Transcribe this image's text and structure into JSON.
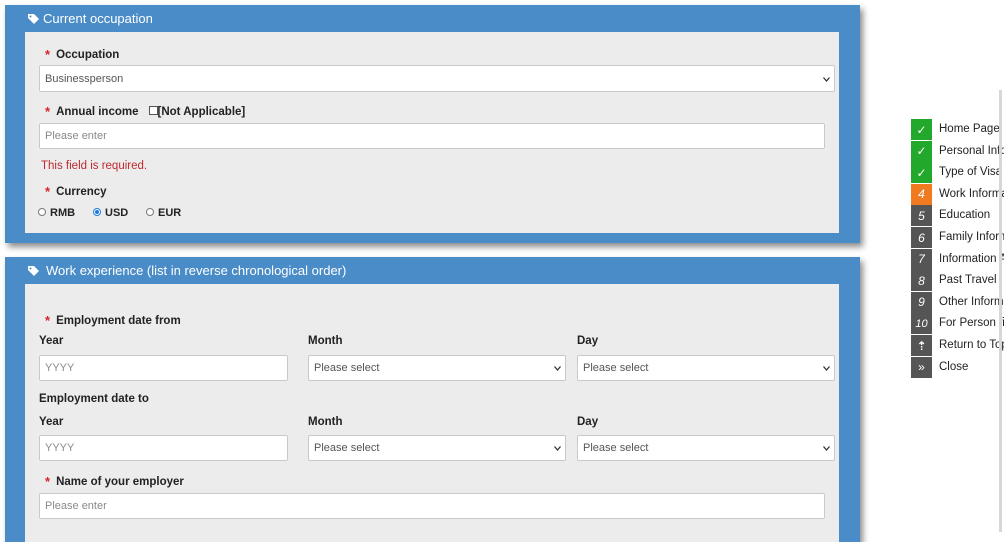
{
  "occupation_panel": {
    "title": "Current occupation",
    "occupation_label": "Occupation",
    "occupation_value": "Businessperson",
    "annual_income_label": "Annual income",
    "not_applicable_label": "[Not Applicable]",
    "annual_income_placeholder": "Please enter",
    "error_text": "This field is required.",
    "currency_label": "Currency",
    "currency_options": [
      "RMB",
      "USD",
      "EUR"
    ],
    "currency_selected": "USD"
  },
  "work_panel": {
    "title": "Work experience (list in reverse chronological order)",
    "from_label": "Employment date from",
    "to_label": "Employment date to",
    "year_label": "Year",
    "month_label": "Month",
    "day_label": "Day",
    "year_placeholder": "YYYY",
    "select_placeholder": "Please select",
    "employer_label": "Name of your employer",
    "employer_placeholder": "Please enter"
  },
  "side_nav": {
    "items": [
      {
        "marker": "✓",
        "label": "Home Page",
        "state": "done"
      },
      {
        "marker": "✓",
        "label": "Personal Infor",
        "state": "done"
      },
      {
        "marker": "✓",
        "label": "Type of Visa",
        "state": "done"
      },
      {
        "marker": "4",
        "label": "Work Informa",
        "state": "current"
      },
      {
        "marker": "5",
        "label": "Education",
        "state": "pending"
      },
      {
        "marker": "6",
        "label": "Family Inform",
        "state": "pending"
      },
      {
        "marker": "7",
        "label": "Information A",
        "state": "pending"
      },
      {
        "marker": "8",
        "label": "Past Travel",
        "state": "pending"
      },
      {
        "marker": "9",
        "label": "Other Informa",
        "state": "pending"
      },
      {
        "marker": "10",
        "label": "For Person fill",
        "state": "pending"
      },
      {
        "marker": "⇡",
        "label": "Return to Top",
        "state": "pending"
      },
      {
        "marker": "»",
        "label": "Close",
        "state": "pending"
      }
    ]
  },
  "colors": {
    "panel_blue": "#4a8cc7",
    "done_green": "#22a82a",
    "current_orange": "#ef7a1f",
    "pending_gray": "#555555",
    "error_red": "#c0282d"
  }
}
